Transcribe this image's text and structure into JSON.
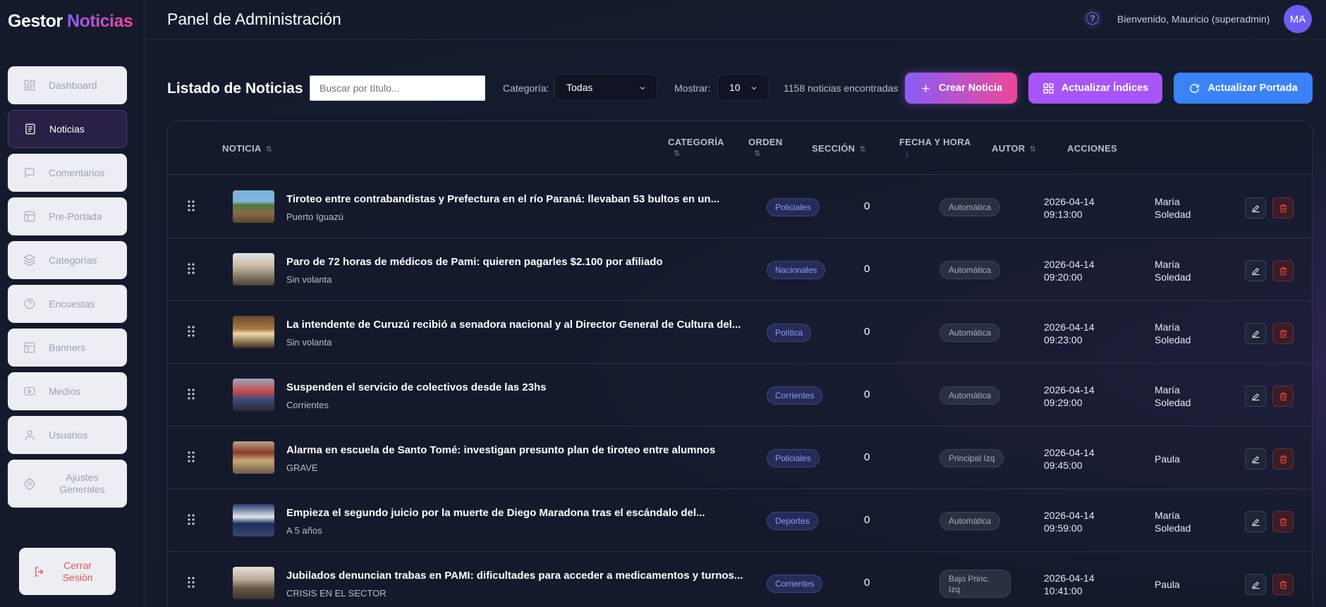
{
  "app": {
    "logo_part1": "Gestor",
    "logo_part2": "Noticias"
  },
  "sidebar": {
    "items": [
      {
        "label": "Dashboard",
        "icon": "dashboard-icon"
      },
      {
        "label": "Noticias",
        "icon": "newspaper-icon",
        "active": true
      },
      {
        "label": "Comentarios",
        "icon": "comment-icon"
      },
      {
        "label": "Pre-Portada",
        "icon": "layout-icon"
      },
      {
        "label": "Categorías",
        "icon": "layers-icon"
      },
      {
        "label": "Encuestas",
        "icon": "question-icon"
      },
      {
        "label": "Banners",
        "icon": "banner-icon"
      },
      {
        "label": "Medios",
        "icon": "video-icon"
      },
      {
        "label": "Usuarios",
        "icon": "user-icon"
      },
      {
        "label": "Ajustes Generales",
        "icon": "gear-icon"
      }
    ],
    "logout_label": "Cerrar Sesión"
  },
  "header": {
    "title": "Panel de Administración",
    "welcome": "Bienvenido, Mauricio (superadmin)",
    "avatar_initials": "MA"
  },
  "toolbar": {
    "list_title": "Listado de Noticias",
    "search_placeholder": "Buscar por título...",
    "category_label": "Categoría:",
    "category_value": "Todas",
    "show_label": "Mostrar:",
    "show_value": "10",
    "count_text": "1158 noticias encontradas",
    "create_label": "Crear Noticia",
    "update_index_label": "Actualizar Índices",
    "update_front_label": "Actualizar Portada"
  },
  "table": {
    "headers": {
      "noticia": "NOTICIA",
      "categoria": "CATEGORÍA",
      "orden": "ORDEN",
      "seccion": "SECCIÓN",
      "fecha": "FECHA Y HORA",
      "autor": "AUTOR",
      "acciones": "ACCIONES"
    },
    "rows": [
      {
        "title": "Tiroteo entre contrabandistas y Prefectura en el río Paraná: llevaban 53 bultos en un...",
        "subtitle": "Puerto Iguazú",
        "category": "Policiales",
        "order": "0",
        "section": "Automática",
        "date": "2026-04-14",
        "time": "09:13:00",
        "author1": "María",
        "author2": "Soledad"
      },
      {
        "title": "Paro de 72 horas de médicos de Pami: quieren pagarles $2.100 por afiliado",
        "subtitle": "Sin volanta",
        "category": "Nacionales",
        "order": "0",
        "section": "Automática",
        "date": "2026-04-14",
        "time": "09:20:00",
        "author1": "María",
        "author2": "Soledad"
      },
      {
        "title": "La intendente de Curuzú recibió a senadora nacional y al Director General de Cultura del...",
        "subtitle": "Sin volanta",
        "category": "Política",
        "order": "0",
        "section": "Automática",
        "date": "2026-04-14",
        "time": "09:23:00",
        "author1": "María",
        "author2": "Soledad"
      },
      {
        "title": "Suspenden el servicio de colectivos desde las 23hs",
        "subtitle": "Corrientes",
        "category": "Corrientes",
        "order": "0",
        "section": "Automática",
        "date": "2026-04-14",
        "time": "09:29:00",
        "author1": "María",
        "author2": "Soledad"
      },
      {
        "title": "Alarma en escuela de Santo Tomé: investigan presunto plan de tiroteo entre alumnos",
        "subtitle": "GRAVE",
        "category": "Policiales",
        "order": "0",
        "section": "Principal Izq",
        "date": "2026-04-14",
        "time": "09:45:00",
        "author1": "Paula",
        "author2": ""
      },
      {
        "title": "Empieza el segundo juicio por la muerte de Diego Maradona tras el escándalo del...",
        "subtitle": "A 5 años",
        "category": "Deportes",
        "order": "0",
        "section": "Automática",
        "date": "2026-04-14",
        "time": "09:59:00",
        "author1": "María",
        "author2": "Soledad"
      },
      {
        "title": "Jubilados denuncian trabas en PAMI: dificultades para acceder a medicamentos y turnos...",
        "subtitle": "CRISIS EN EL SECTOR",
        "category": "Corrientes",
        "order": "0",
        "section": "Bajo Princ. Izq",
        "date": "2026-04-14",
        "time": "10:41:00",
        "author1": "Paula",
        "author2": ""
      }
    ]
  },
  "colors": {
    "accent_purple": "#8b5cf6",
    "accent_pink": "#ec4899",
    "accent_blue": "#3b82f6",
    "danger": "#ef4444"
  }
}
